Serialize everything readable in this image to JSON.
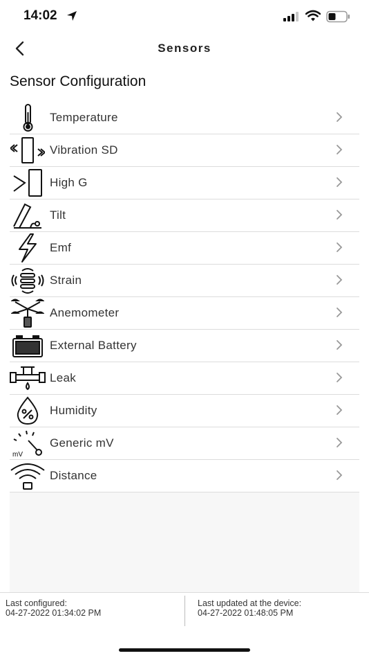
{
  "status_bar": {
    "time": "14:02",
    "location_icon": "location-arrow-icon",
    "signal_icon": "cellular-signal-icon",
    "wifi_icon": "wifi-icon",
    "battery_icon": "battery-icon"
  },
  "nav": {
    "title": "Sensors",
    "back_icon": "chevron-left-icon"
  },
  "section_title": "Sensor Configuration",
  "sensors": [
    {
      "label": "Temperature",
      "icon": "thermometer-icon"
    },
    {
      "label": "Vibration SD",
      "icon": "vibration-icon"
    },
    {
      "label": "High G",
      "icon": "high-g-icon"
    },
    {
      "label": "Tilt",
      "icon": "tilt-icon"
    },
    {
      "label": "Emf",
      "icon": "lightning-icon"
    },
    {
      "label": "Strain",
      "icon": "strain-icon"
    },
    {
      "label": "Anemometer",
      "icon": "anemometer-icon"
    },
    {
      "label": "External Battery",
      "icon": "car-battery-icon"
    },
    {
      "label": "Leak",
      "icon": "pipe-leak-icon"
    },
    {
      "label": "Humidity",
      "icon": "humidity-drop-icon"
    },
    {
      "label": "Generic mV",
      "icon": "voltmeter-icon"
    },
    {
      "label": "Distance",
      "icon": "distance-wave-icon"
    }
  ],
  "footer": {
    "last_configured_label": "Last configured:",
    "last_configured_value": "04-27-2022 01:34:02 PM",
    "last_updated_label": "Last updated at the device:",
    "last_updated_value": "04-27-2022 01:48:05 PM"
  },
  "colors": {
    "background": "#ffffff",
    "panel": "#f7f7f7",
    "divider": "#dcdcdc",
    "text": "#333333",
    "chevron": "#999999"
  }
}
